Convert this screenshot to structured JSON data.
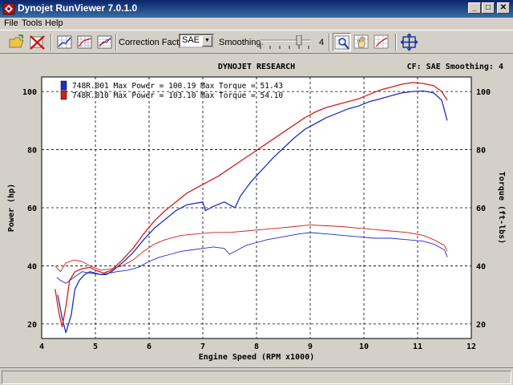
{
  "window": {
    "title": "Dynojet RunViewer 7.0.1.0",
    "minimize": "_",
    "maximize": "□",
    "close": "✕"
  },
  "menu": {
    "items": [
      "File",
      "Tools",
      "Help"
    ]
  },
  "toolbar": {
    "correction_label": "Correction Factor:",
    "correction_value": "SAE",
    "smoothing_label": "Smoothing:",
    "smoothing_value": "4",
    "smoothing_level": 4,
    "smoothing_max": 5
  },
  "header": {
    "center": "DYNOJET RESEARCH",
    "right": "CF: SAE  Smoothing: 4"
  },
  "colors": {
    "run1": "#1c2fc4",
    "run2": "#d21c1c",
    "plot_bg": "#ffffff"
  },
  "chart_data": {
    "type": "line",
    "title": "DYNOJET RESEARCH",
    "xlabel": "Engine Speed (RPM x1000)",
    "ylabel": "Power (hp)",
    "y2label": "Torque (ft-lbs)",
    "xlim": [
      4,
      12
    ],
    "ylim": [
      15,
      105
    ],
    "x_ticks": [
      4,
      5,
      6,
      7,
      8,
      9,
      10,
      11,
      12
    ],
    "y_ticks": [
      20,
      40,
      60,
      80,
      100
    ],
    "legend": [
      {
        "text": "748R.001 Max Power = 100.19 Max Torque = 51.43",
        "color": "#1c2fc4"
      },
      {
        "text": "748R.010 Max Power = 103.10 Max Torque = 54.10",
        "color": "#d21c1c"
      }
    ],
    "series": [
      {
        "name": "748R.001",
        "kind": "power",
        "color": "#1c2fc4",
        "points": [
          [
            4.3,
            30
          ],
          [
            4.38,
            22
          ],
          [
            4.45,
            17
          ],
          [
            4.55,
            23
          ],
          [
            4.62,
            32
          ],
          [
            4.7,
            35
          ],
          [
            4.8,
            37
          ],
          [
            4.9,
            38
          ],
          [
            5.0,
            37.5
          ],
          [
            5.1,
            37
          ],
          [
            5.2,
            37
          ],
          [
            5.3,
            38
          ],
          [
            5.5,
            41
          ],
          [
            5.7,
            44.5
          ],
          [
            5.9,
            49
          ],
          [
            6.1,
            53
          ],
          [
            6.3,
            56
          ],
          [
            6.5,
            59
          ],
          [
            6.7,
            61
          ],
          [
            7.0,
            62
          ],
          [
            7.05,
            59
          ],
          [
            7.2,
            60.5
          ],
          [
            7.4,
            62
          ],
          [
            7.5,
            61
          ],
          [
            7.6,
            60
          ],
          [
            7.7,
            64
          ],
          [
            7.9,
            69
          ],
          [
            8.1,
            73
          ],
          [
            8.3,
            77
          ],
          [
            8.5,
            80.5
          ],
          [
            8.7,
            84
          ],
          [
            8.9,
            87
          ],
          [
            9.1,
            89
          ],
          [
            9.3,
            91
          ],
          [
            9.5,
            92.5
          ],
          [
            9.7,
            94
          ],
          [
            9.9,
            95
          ],
          [
            10.1,
            96.5
          ],
          [
            10.3,
            97.5
          ],
          [
            10.5,
            98.5
          ],
          [
            10.7,
            99.5
          ],
          [
            10.9,
            100
          ],
          [
            11.1,
            100.19
          ],
          [
            11.3,
            99.5
          ],
          [
            11.45,
            97
          ],
          [
            11.55,
            90
          ]
        ]
      },
      {
        "name": "748R.001",
        "kind": "torque",
        "color": "#1c2fc4",
        "points": [
          [
            4.28,
            36
          ],
          [
            4.35,
            35
          ],
          [
            4.45,
            34
          ],
          [
            4.6,
            36
          ],
          [
            4.75,
            38
          ],
          [
            4.9,
            37.5
          ],
          [
            5.1,
            37
          ],
          [
            5.25,
            37.5
          ],
          [
            5.4,
            38
          ],
          [
            5.6,
            38.5
          ],
          [
            5.8,
            39.5
          ],
          [
            6.0,
            41.5
          ],
          [
            6.2,
            43
          ],
          [
            6.4,
            44
          ],
          [
            6.6,
            45
          ],
          [
            6.8,
            45.5
          ],
          [
            7.0,
            46
          ],
          [
            7.2,
            46.5
          ],
          [
            7.4,
            46
          ],
          [
            7.5,
            44
          ],
          [
            7.65,
            45.5
          ],
          [
            7.8,
            47
          ],
          [
            8.0,
            48
          ],
          [
            8.2,
            49
          ],
          [
            8.5,
            50
          ],
          [
            8.8,
            51
          ],
          [
            9.0,
            51.43
          ],
          [
            9.3,
            51
          ],
          [
            9.6,
            50.5
          ],
          [
            9.9,
            50
          ],
          [
            10.2,
            49.5
          ],
          [
            10.5,
            49.5
          ],
          [
            10.8,
            49
          ],
          [
            11.1,
            48.5
          ],
          [
            11.3,
            47.5
          ],
          [
            11.5,
            45.5
          ],
          [
            11.55,
            43
          ]
        ]
      },
      {
        "name": "748R.010",
        "kind": "power",
        "color": "#d21c1c",
        "points": [
          [
            4.25,
            32
          ],
          [
            4.32,
            24
          ],
          [
            4.38,
            19
          ],
          [
            4.45,
            26
          ],
          [
            4.52,
            35
          ],
          [
            4.62,
            38
          ],
          [
            4.75,
            39
          ],
          [
            4.9,
            39.5
          ],
          [
            5.0,
            38.5
          ],
          [
            5.15,
            37.5
          ],
          [
            5.3,
            38.5
          ],
          [
            5.5,
            42
          ],
          [
            5.7,
            46
          ],
          [
            5.9,
            51
          ],
          [
            6.1,
            55.5
          ],
          [
            6.3,
            59
          ],
          [
            6.5,
            62
          ],
          [
            6.7,
            65
          ],
          [
            6.9,
            67
          ],
          [
            7.1,
            69
          ],
          [
            7.3,
            71
          ],
          [
            7.5,
            73.5
          ],
          [
            7.7,
            76
          ],
          [
            7.9,
            78.5
          ],
          [
            8.1,
            81
          ],
          [
            8.3,
            83.5
          ],
          [
            8.5,
            86
          ],
          [
            8.7,
            88.5
          ],
          [
            8.9,
            91
          ],
          [
            9.1,
            93
          ],
          [
            9.3,
            94.5
          ],
          [
            9.5,
            95.5
          ],
          [
            9.7,
            96.5
          ],
          [
            9.9,
            97.5
          ],
          [
            10.1,
            99
          ],
          [
            10.3,
            100.5
          ],
          [
            10.5,
            101.5
          ],
          [
            10.7,
            102.5
          ],
          [
            10.9,
            103.1
          ],
          [
            11.1,
            102.8
          ],
          [
            11.3,
            102
          ],
          [
            11.45,
            100
          ],
          [
            11.55,
            97
          ]
        ]
      },
      {
        "name": "748R.010",
        "kind": "torque",
        "color": "#d21c1c",
        "points": [
          [
            4.25,
            40
          ],
          [
            4.35,
            38
          ],
          [
            4.45,
            41
          ],
          [
            4.6,
            42
          ],
          [
            4.75,
            41.5
          ],
          [
            4.9,
            40
          ],
          [
            5.1,
            38.5
          ],
          [
            5.3,
            39
          ],
          [
            5.5,
            40
          ],
          [
            5.7,
            42
          ],
          [
            5.9,
            45
          ],
          [
            6.1,
            47.5
          ],
          [
            6.3,
            49
          ],
          [
            6.6,
            50.5
          ],
          [
            6.9,
            51
          ],
          [
            7.2,
            51.5
          ],
          [
            7.5,
            51.5
          ],
          [
            7.8,
            52
          ],
          [
            8.1,
            52.5
          ],
          [
            8.4,
            53
          ],
          [
            8.7,
            53.5
          ],
          [
            9.0,
            54.1
          ],
          [
            9.3,
            53.8
          ],
          [
            9.6,
            53.5
          ],
          [
            9.9,
            53
          ],
          [
            10.2,
            52.5
          ],
          [
            10.5,
            52
          ],
          [
            10.8,
            51.5
          ],
          [
            11.1,
            50.5
          ],
          [
            11.3,
            49
          ],
          [
            11.5,
            47
          ],
          [
            11.55,
            45
          ]
        ]
      }
    ]
  },
  "icons": [
    "open-folder-icon",
    "delete-run-icon",
    "graph-view-icon",
    "graph-grid-icon",
    "graph-bars-icon",
    "zoom-icon",
    "pan-hand-icon",
    "cursor-icon",
    "crosshair-icon"
  ]
}
